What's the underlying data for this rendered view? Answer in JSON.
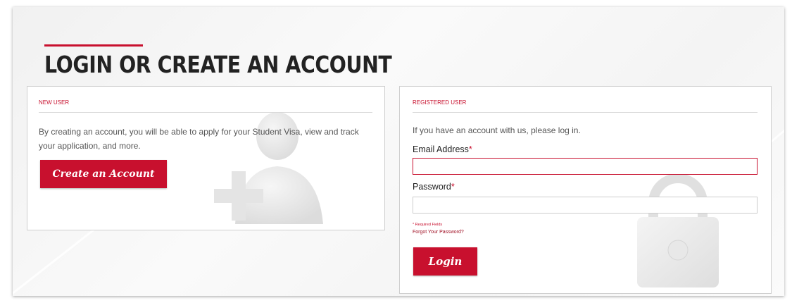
{
  "page": {
    "title": "LOGIN OR CREATE AN ACCOUNT",
    "accent_color": "#c8102e"
  },
  "new_user": {
    "heading": "NEW USER",
    "description": "By creating an account, you will be able to apply for your Student Visa, view and track your application, and more.",
    "button_label": "Create an Account",
    "watermark_icon": "add-user-icon"
  },
  "registered_user": {
    "heading": "REGISTERED USER",
    "intro": "If you have an account with us, please log in.",
    "email_label": "Email Address",
    "email_value": "",
    "password_label": "Password",
    "password_value": "",
    "required_marker": "*",
    "required_note": "* Required Fields",
    "forgot_link": "Forgot Your Password?",
    "login_button": "Login",
    "watermark_icon": "lock-icon"
  }
}
